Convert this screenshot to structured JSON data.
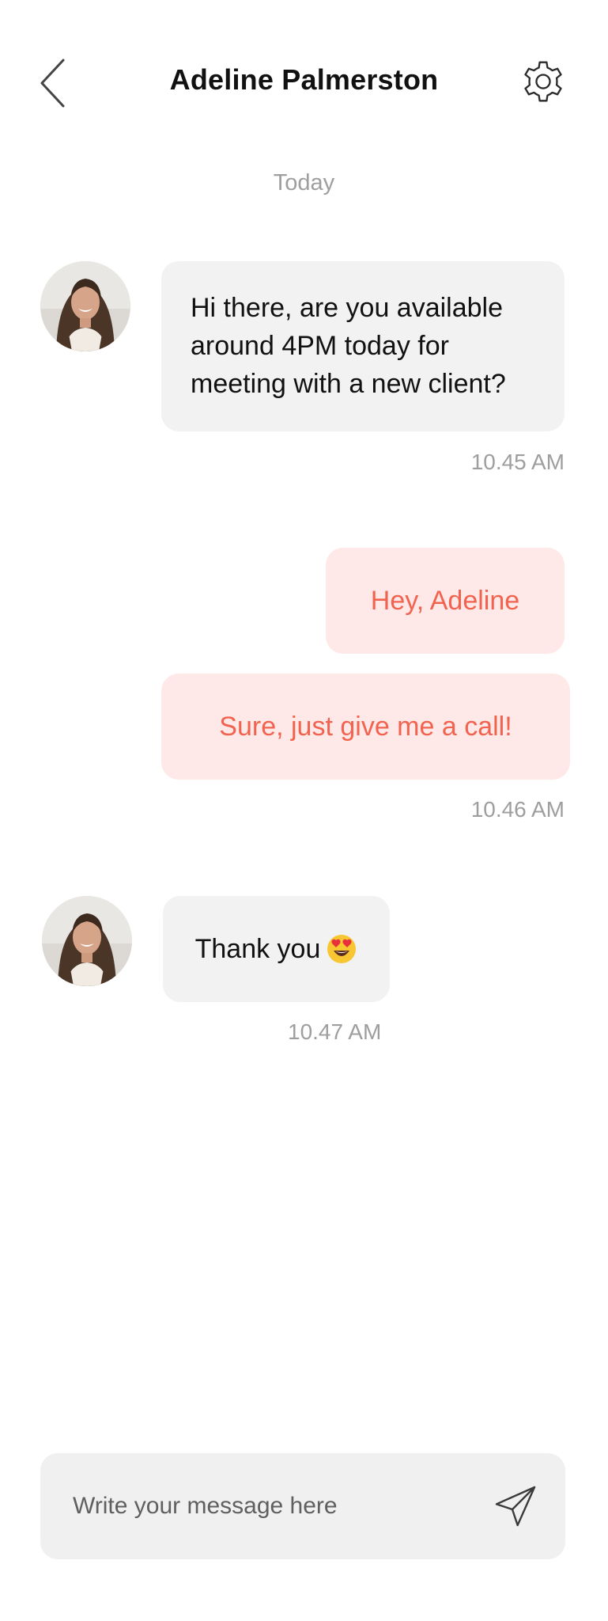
{
  "header": {
    "title": "Adeline Palmerston",
    "back_icon": "chevron-left-icon",
    "settings_icon": "gear-icon"
  },
  "date_divider": "Today",
  "messages": [
    {
      "direction": "incoming",
      "lines": [
        "Hi there, are you available",
        "around 4PM today for",
        "meeting with a new client?"
      ]
    },
    {
      "direction": "outgoing",
      "text": "Hey, Adeline"
    },
    {
      "direction": "outgoing",
      "text": "Sure, just give me a call!"
    },
    {
      "direction": "incoming",
      "text": "Thank you",
      "emoji": "heart-eyes-emoji"
    }
  ],
  "timestamps": [
    "10.45 AM",
    "10.46 AM",
    "10.47 AM"
  ],
  "composer": {
    "placeholder": "Write your message here",
    "value": "",
    "send_icon": "send-icon"
  },
  "colors": {
    "incoming_bubble": "#f2f2f2",
    "outgoing_bubble": "#ffe9e8",
    "outgoing_text": "#f2634f",
    "muted_text": "#9e9e9e",
    "composer_bg": "#f0f0f0"
  }
}
